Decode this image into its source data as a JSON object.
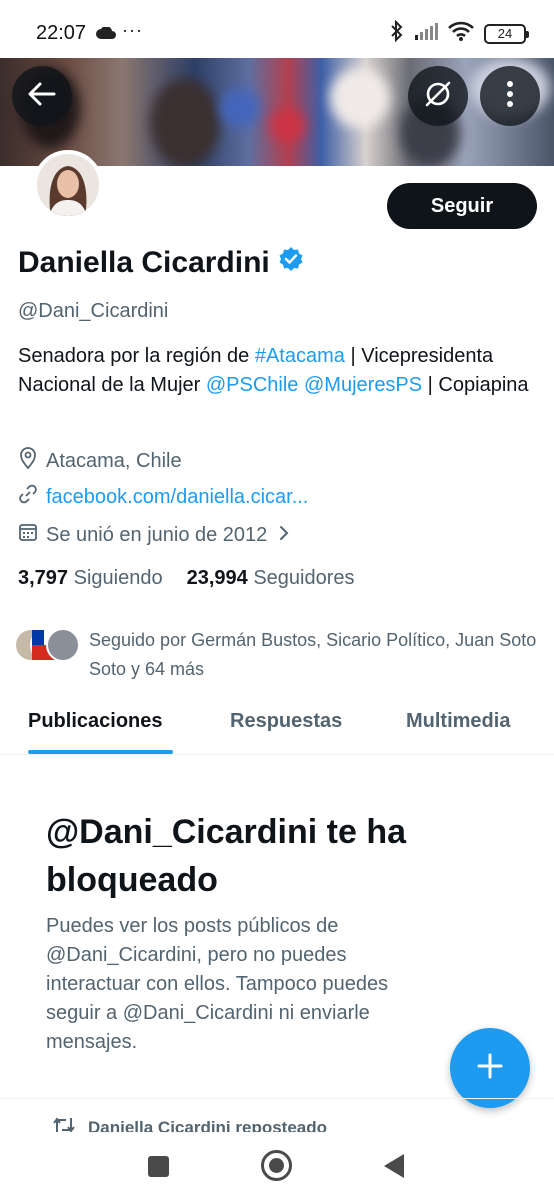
{
  "status_bar": {
    "time": "22:07",
    "dots": "···",
    "battery": "24",
    "icons": [
      "cloud-icon",
      "bluetooth-icon",
      "signal-icon",
      "wifi-icon",
      "battery-icon"
    ]
  },
  "header": {
    "back_icon": "arrow-left-icon",
    "grok_icon": "circle-slash-icon",
    "more_icon": "vertical-dots-icon"
  },
  "profile": {
    "follow_label": "Seguir",
    "name": "Daniella Cicardini",
    "verified": true,
    "handle": "@Dani_Cicardini",
    "bio": {
      "p1": "Senadora por la región de ",
      "l1": "#Atacama",
      "p2": " | Vicepresidenta Nacional de la Mujer ",
      "l2": "@PSChile",
      "p3": " ",
      "l3": "@MujeresPS",
      "p4": " | Copiapina"
    },
    "location": "Atacama, Chile",
    "website": "facebook.com/daniella.cicar...",
    "joined": "Se unió en junio de 2012",
    "following_count": "3,797",
    "following_label": "Siguiendo",
    "followers_count": "23,994",
    "followers_label": "Seguidores",
    "followed_by": "Seguido por Germán Bustos, Sicario Político, Juan Soto Soto y 64 más"
  },
  "tabs": [
    {
      "label": "Publicaciones",
      "active": true
    },
    {
      "label": "Respuestas",
      "active": false
    },
    {
      "label": "Multimedia",
      "active": false
    }
  ],
  "blocked": {
    "title": "@Dani_Cicardini te ha bloqueado",
    "description": "Puedes ver los posts públicos de @Dani_Cicardini, pero no puedes interactuar con ellos. Tampoco puedes seguir a @Dani_Cicardini ni enviarle mensajes."
  },
  "fab": {
    "icon": "plus-icon"
  },
  "feed": {
    "repost_label": "Daniella Cicardini reposteado"
  },
  "colors": {
    "accent": "#1d9bf0",
    "text": "#0f1419",
    "secondary": "#536471"
  }
}
